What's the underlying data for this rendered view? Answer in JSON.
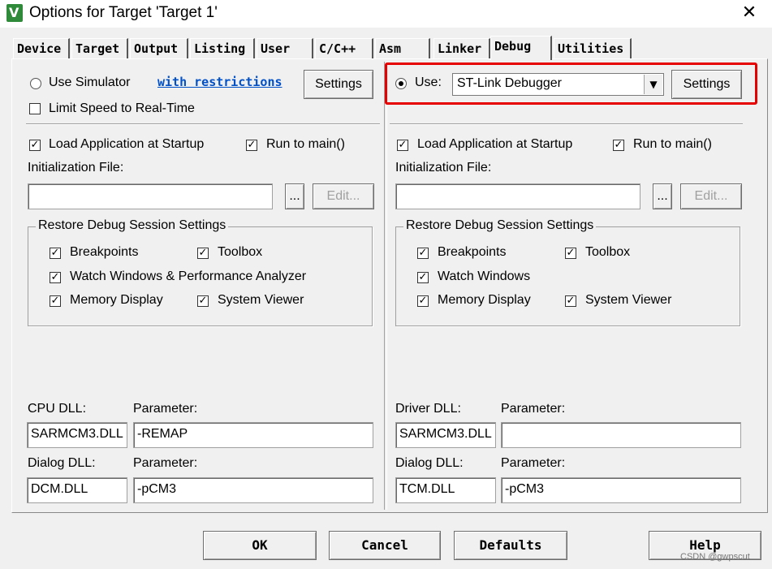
{
  "window": {
    "title": "Options for Target 'Target 1'",
    "close_glyph": "✕"
  },
  "tabs": [
    {
      "label": "Device"
    },
    {
      "label": "Target"
    },
    {
      "label": "Output"
    },
    {
      "label": "Listing"
    },
    {
      "label": "User"
    },
    {
      "label": "C/C++"
    },
    {
      "label": "Asm"
    },
    {
      "label": "Linker"
    },
    {
      "label": "Debug",
      "active": true
    },
    {
      "label": "Utilities"
    }
  ],
  "left": {
    "use_simulator": "Use Simulator",
    "restrictions_link": "with restrictions",
    "settings": "Settings",
    "limit_speed": "Limit Speed to Real-Time",
    "load_app": "Load Application at Startup",
    "run_to_main": "Run to main()",
    "init_file_label": "Initialization File:",
    "init_file_value": "",
    "browse": "...",
    "edit": "Edit...",
    "restore_group": "Restore Debug Session Settings",
    "breakpoints": "Breakpoints",
    "toolbox": "Toolbox",
    "watch": "Watch Windows & Performance Analyzer",
    "memory": "Memory Display",
    "sysviewer": "System Viewer",
    "cpu_dll_label": "CPU DLL:",
    "param_label": "Parameter:",
    "cpu_dll": "SARMCM3.DLL",
    "cpu_param": "-REMAP",
    "dialog_dll_label": "Dialog DLL:",
    "dialog_dll": "DCM.DLL",
    "dialog_param": "-pCM3"
  },
  "right": {
    "use": "Use:",
    "debugger": "ST-Link Debugger",
    "settings": "Settings",
    "load_app": "Load Application at Startup",
    "run_to_main": "Run to main()",
    "init_file_label": "Initialization File:",
    "init_file_value": "",
    "browse": "...",
    "edit": "Edit...",
    "restore_group": "Restore Debug Session Settings",
    "breakpoints": "Breakpoints",
    "toolbox": "Toolbox",
    "watch": "Watch Windows",
    "memory": "Memory Display",
    "sysviewer": "System Viewer",
    "driver_dll_label": "Driver DLL:",
    "param_label": "Parameter:",
    "driver_dll": "SARMCM3.DLL",
    "driver_param": "",
    "dialog_dll_label": "Dialog DLL:",
    "dialog_dll": "TCM.DLL",
    "dialog_param": "-pCM3"
  },
  "footer": {
    "ok": "OK",
    "cancel": "Cancel",
    "defaults": "Defaults",
    "help": "Help"
  },
  "check_glyph": "✓",
  "watermark": "CSDN @gwpscut",
  "colors": {
    "highlight": "#e60000",
    "link": "#0050c8"
  }
}
